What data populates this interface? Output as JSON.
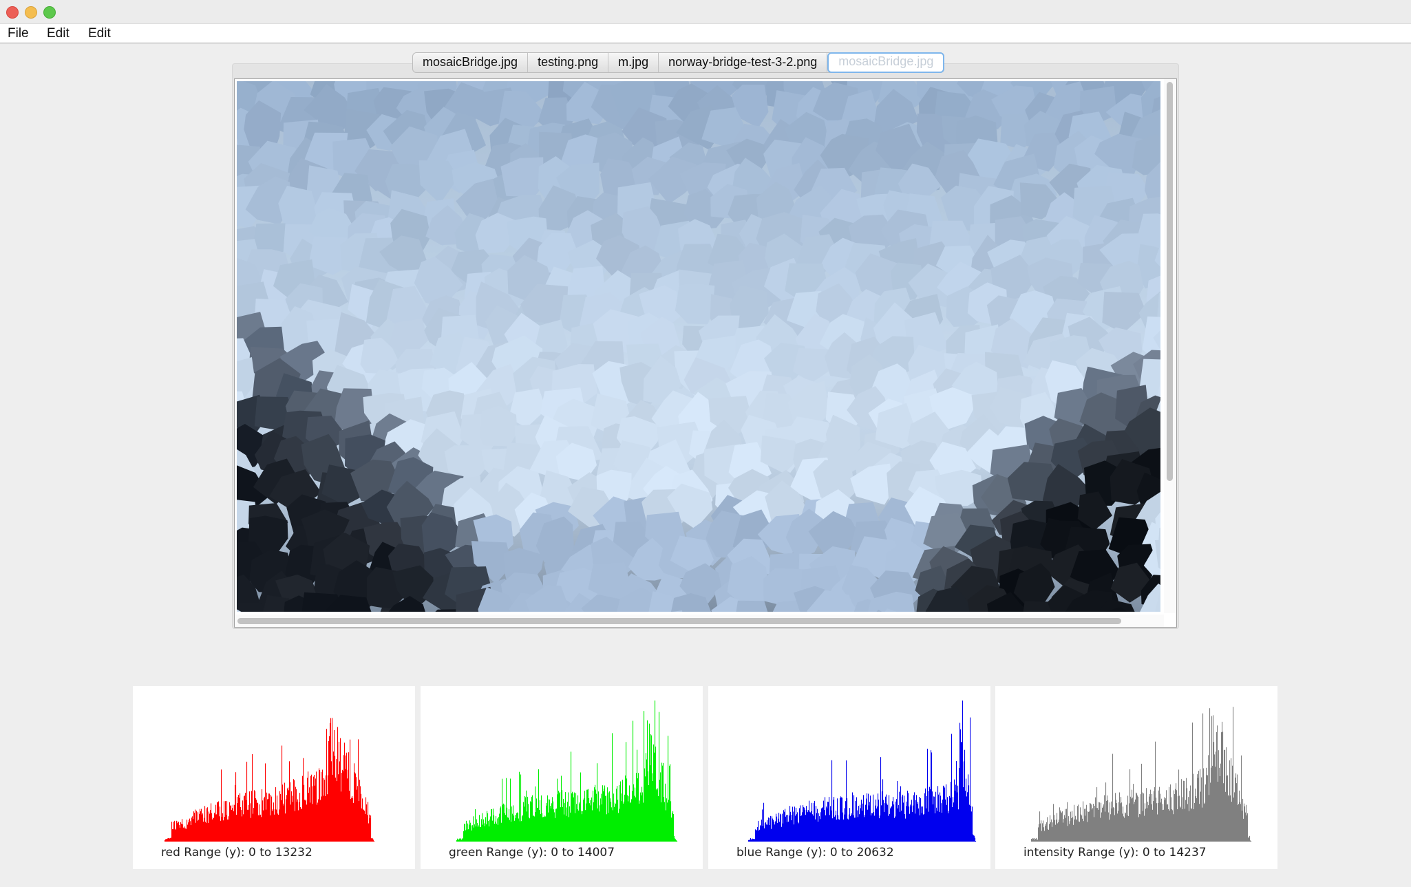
{
  "window": {
    "menu": [
      "File",
      "Edit",
      "Edit"
    ]
  },
  "tabs": [
    {
      "label": "mosaicBridge.jpg",
      "selected": false
    },
    {
      "label": "testing.png",
      "selected": false
    },
    {
      "label": "m.jpg",
      "selected": false
    },
    {
      "label": "norway-bridge-test-3-2.png",
      "selected": false
    },
    {
      "label": "mosaicBridge.jpg",
      "selected": true
    }
  ],
  "image_view": {
    "description_icon": "mosaic-image",
    "scroll_vertical_fraction": 0.75,
    "scroll_horizontal_fraction": 0.96
  },
  "histograms": [
    {
      "channel": "red",
      "caption": "red Range (y): 0 to 13232",
      "color": "#ff0000"
    },
    {
      "channel": "green",
      "caption": "green Range (y): 0 to 14007",
      "color": "#00ee00"
    },
    {
      "channel": "blue",
      "caption": "blue Range (y): 0 to 20632",
      "color": "#0000ee"
    },
    {
      "channel": "intensity",
      "caption": "intensity Range (y): 0 to 14237",
      "color": "#808080"
    }
  ]
}
